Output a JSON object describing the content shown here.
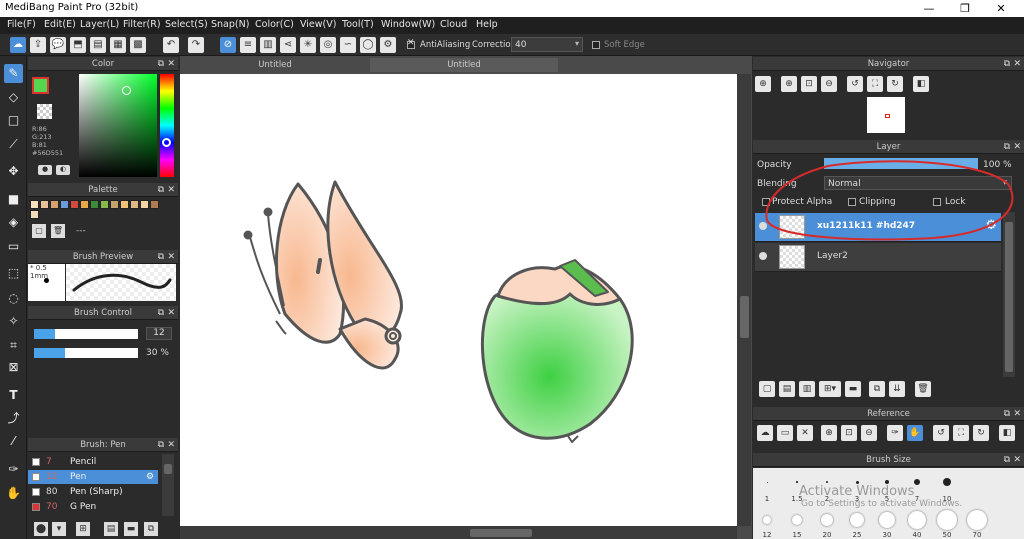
{
  "window": {
    "title": "MediBang Paint Pro (32bit)",
    "minimize": "—",
    "maximize": "❐",
    "close": "✕"
  },
  "menu": [
    "File(F)",
    "Edit(E)",
    "Layer(L)",
    "Filter(R)",
    "Select(S)",
    "Snap(N)",
    "Color(C)",
    "View(V)",
    "Tool(T)",
    "Window(W)",
    "Cloud",
    "Help"
  ],
  "toolbar": {
    "antialiasing_label": "AntiAliasing",
    "correction_label": "Correction",
    "correction_value": "40",
    "soft_edge_label": "Soft Edge"
  },
  "color_panel": {
    "title": "Color",
    "r": "R:86",
    "g": "G:213",
    "b": "B:81",
    "hex": "#56D551",
    "accent": "#56D551"
  },
  "palette": {
    "title": "Palette",
    "swatches": [
      "#f7e1c0",
      "#e8c09a",
      "#d7a06f",
      "#6b9bd6",
      "#d24b3f",
      "#e9a848",
      "#3c8b3a",
      "#86b84a",
      "#c4a36a",
      "#f0c27a",
      "#e0b884",
      "#f3d2a4",
      "#b07b4f",
      "#efdcb8"
    ],
    "more": "---"
  },
  "brush_preview": {
    "title": "Brush Preview",
    "size": "* 0.5 1mm"
  },
  "brush_control": {
    "title": "Brush Control",
    "size_value": "12",
    "opacity_value": "30 %",
    "size_fraction": 0.2,
    "opacity_fraction": 0.3
  },
  "brush_list": {
    "title": "Brush: Pen",
    "items": [
      {
        "size": "7",
        "name": "Pencil",
        "selected": false
      },
      {
        "size": "12",
        "name": "Pen",
        "selected": true
      },
      {
        "size": "80",
        "name": "Pen (Sharp)",
        "selected": false
      },
      {
        "size": "70",
        "name": "G Pen",
        "selected": false
      }
    ]
  },
  "canvas": {
    "tabs": [
      "Untitled",
      "Untitled"
    ]
  },
  "navigator": {
    "title": "Navigator"
  },
  "layer_panel": {
    "title": "Layer",
    "opacity_label": "Opacity",
    "opacity_value": "100 %",
    "opacity_fraction": 1.0,
    "blending_label": "Blending",
    "blending_value": "Normal",
    "protect_alpha_label": "Protect Alpha",
    "clipping_label": "Clipping",
    "lock_label": "Lock",
    "layers": [
      {
        "name": "xu1211k11 #hd247",
        "selected": true
      },
      {
        "name": "Layer2",
        "selected": false
      }
    ]
  },
  "reference": {
    "title": "Reference"
  },
  "brush_size": {
    "title": "Brush Size",
    "row1": [
      "1",
      "1.5",
      "2",
      "3",
      "5",
      "7",
      "10"
    ],
    "row2": [
      "12",
      "15",
      "20",
      "25",
      "30",
      "40",
      "50",
      "70"
    ]
  },
  "watermark": {
    "line1": "Activate Windows",
    "line2": "Go to Settings to activate Windows."
  },
  "colors": {
    "selection": "#4a8fd8",
    "annotation": "#d62b2b"
  }
}
